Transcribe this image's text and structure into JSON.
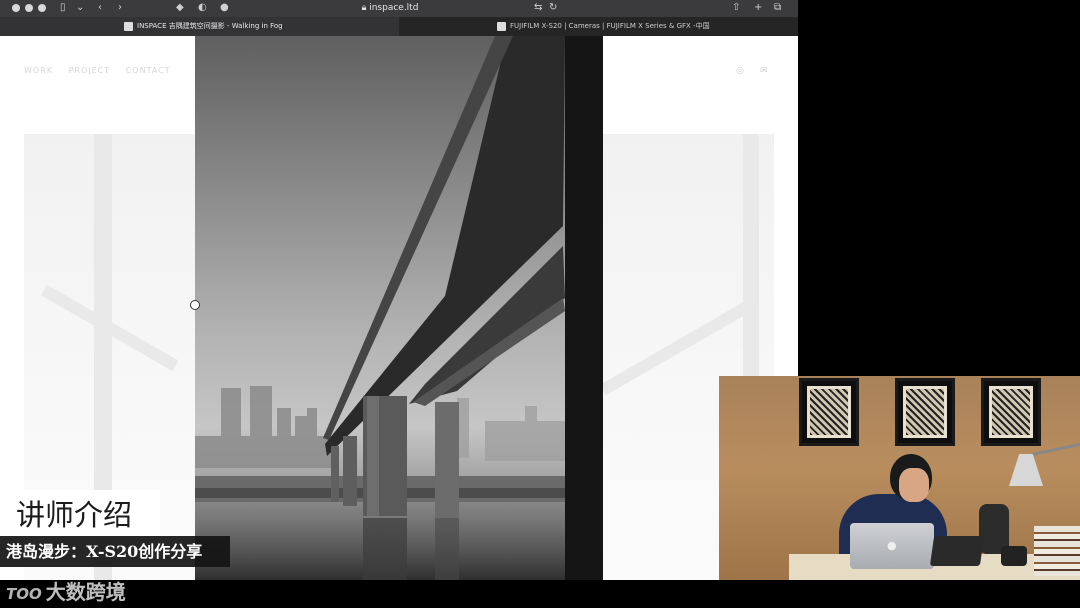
{
  "browser": {
    "address": "inspace.ltd",
    "tabs": [
      {
        "label": "INSPACE 吉隅建筑空间摄影 - Walking in Fog",
        "active": true
      },
      {
        "label": "FUJIFILM X-S20 | Cameras | FUJIFILM X Series & GFX -中国",
        "active": false
      }
    ]
  },
  "site": {
    "nav": [
      "WORK",
      "PROJECT",
      "CONTACT"
    ]
  },
  "captions": {
    "section": "讲师介绍",
    "title": "港岛漫步：X-S20创作分享"
  },
  "watermark": {
    "logo": "TOO",
    "text": "大数跨境"
  },
  "colors": {
    "chrome": "#3b3b3d",
    "tabbar": "#252526",
    "wall": "#b98d5e"
  }
}
